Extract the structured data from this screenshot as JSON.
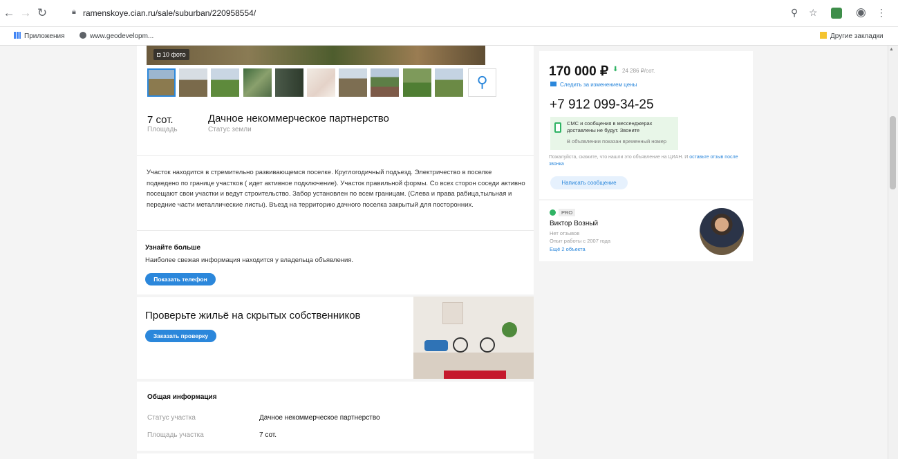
{
  "browser": {
    "url": "ramenskoye.cian.ru/sale/suburban/220958554/",
    "bookmarks": [
      "Приложения",
      "www.geodevelopm..."
    ],
    "other_bookmarks": "Другие закладки"
  },
  "listing": {
    "photo_count": "10 фото",
    "area_value": "7 сот.",
    "area_label": "Площадь",
    "status_value": "Дачное некоммерческое партнерство",
    "status_label": "Статус земли",
    "description": "Участок находится в стремительно развивающемся поселке. Круглогодичный подъезд. Электричество в поселке подведено по границе участков ( идет активное подключение). Участок правильной формы. Со всех сторон соседи активно посещают свои участки и ведут строительство. Забор установлен по всем границам. (Слева и права рабица,тыльная и передние части металлические листы). Въезд на территорию дачного поселка закрытый для посторонних."
  },
  "learn_more": {
    "title": "Узнайте больше",
    "text": "Наиболее свежая информация находится у владельца объявления.",
    "button": "Показать телефон"
  },
  "check_owners": {
    "title": "Проверьте жильё на скрытых собственников",
    "button": "Заказать проверку"
  },
  "general_info": {
    "title": "Общая информация",
    "rows": [
      {
        "label": "Статус участка",
        "value": "Дачное некоммерческое партнерство"
      },
      {
        "label": "Площадь участка",
        "value": "7 сот."
      }
    ]
  },
  "sidebar": {
    "price": "170 000 ₽",
    "price_per": "24 286 ₽/сот.",
    "follow_price": "Следить за изменением цены",
    "phone": "+7 912 099-34-25",
    "sms_line1": "СМС и сообщения в мессенджерах",
    "sms_line2": "доставлены не будут. Звоните",
    "sms_line3": "В объявлении показан временный номер",
    "hint_text": "Пожалуйста, скажите, что нашли это объявление на ЦИАН. И",
    "hint_link": "оставьте отзыв после звонка",
    "write_button": "Написать сообщение",
    "agent_badge": "PRO",
    "agent_name": "Виктор Возный",
    "agent_reviews": "Нет отзывов",
    "agent_experience": "Опыт работы с 2007 года",
    "agent_more": "Ещё 2 объекта"
  },
  "colors": {
    "accent": "#2b87db",
    "green": "#2fb364"
  }
}
